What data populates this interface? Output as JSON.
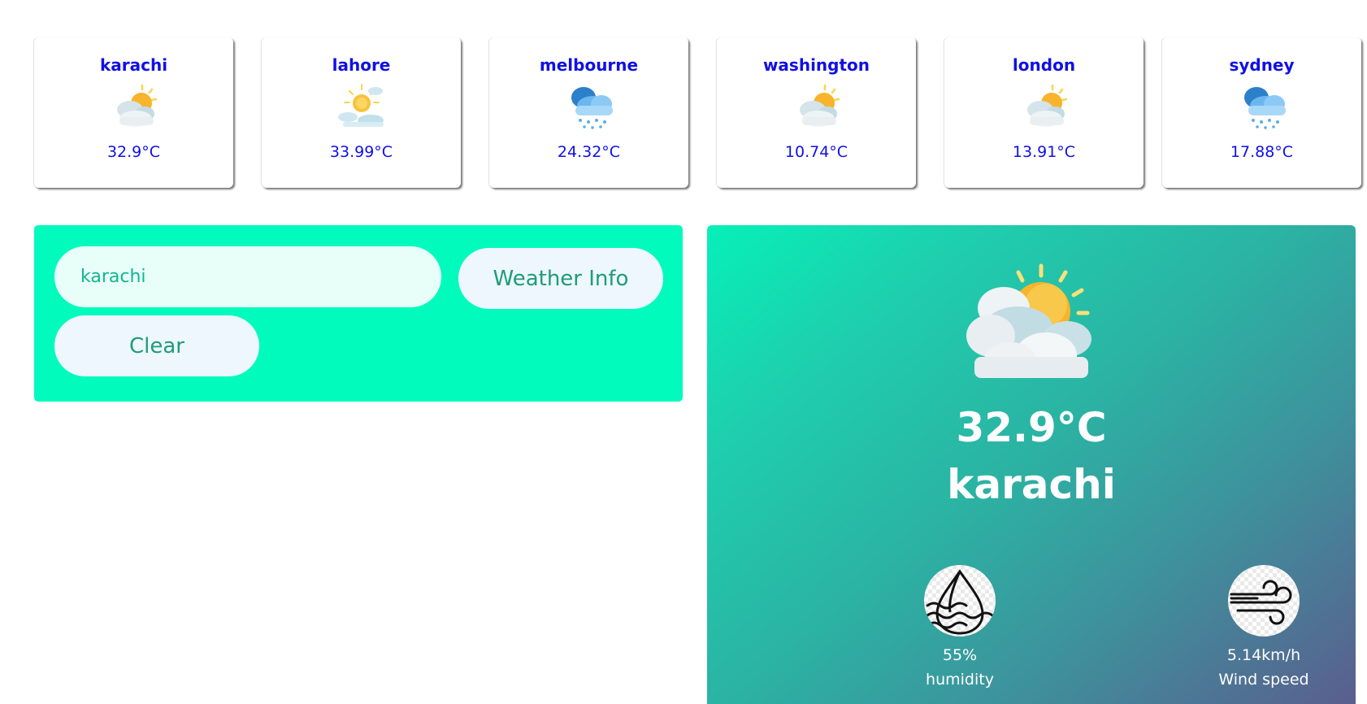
{
  "cities": [
    {
      "name": "karachi",
      "temp": "32.9°C",
      "icon": "partly-cloudy-sun-icon"
    },
    {
      "name": "lahore",
      "temp": "33.99°C",
      "icon": "sun-haze-icon"
    },
    {
      "name": "melbourne",
      "temp": "24.32°C",
      "icon": "rain-cloud-icon"
    },
    {
      "name": "washington",
      "temp": "10.74°C",
      "icon": "partly-cloudy-sun-icon"
    },
    {
      "name": "london",
      "temp": "13.91°C",
      "icon": "partly-cloudy-sun-icon"
    },
    {
      "name": "sydney",
      "temp": "17.88°C",
      "icon": "rain-cloud-icon"
    }
  ],
  "search": {
    "value": "karachi",
    "weather_info_label": "Weather Info",
    "clear_label": "Clear"
  },
  "current": {
    "temp": "32.9°C",
    "city": "karachi",
    "icon": "partly-cloudy-sun-icon",
    "humidity_value": "55%",
    "humidity_label": "humidity",
    "wind_value": "5.14km/h",
    "wind_label": "Wind speed"
  },
  "colors": {
    "city_text": "#1010e6",
    "search_panel": "#00fbbd",
    "button_text": "#1f9b7c",
    "gradient_start": "#06f0b8",
    "gradient_end": "#5a5e8e"
  }
}
